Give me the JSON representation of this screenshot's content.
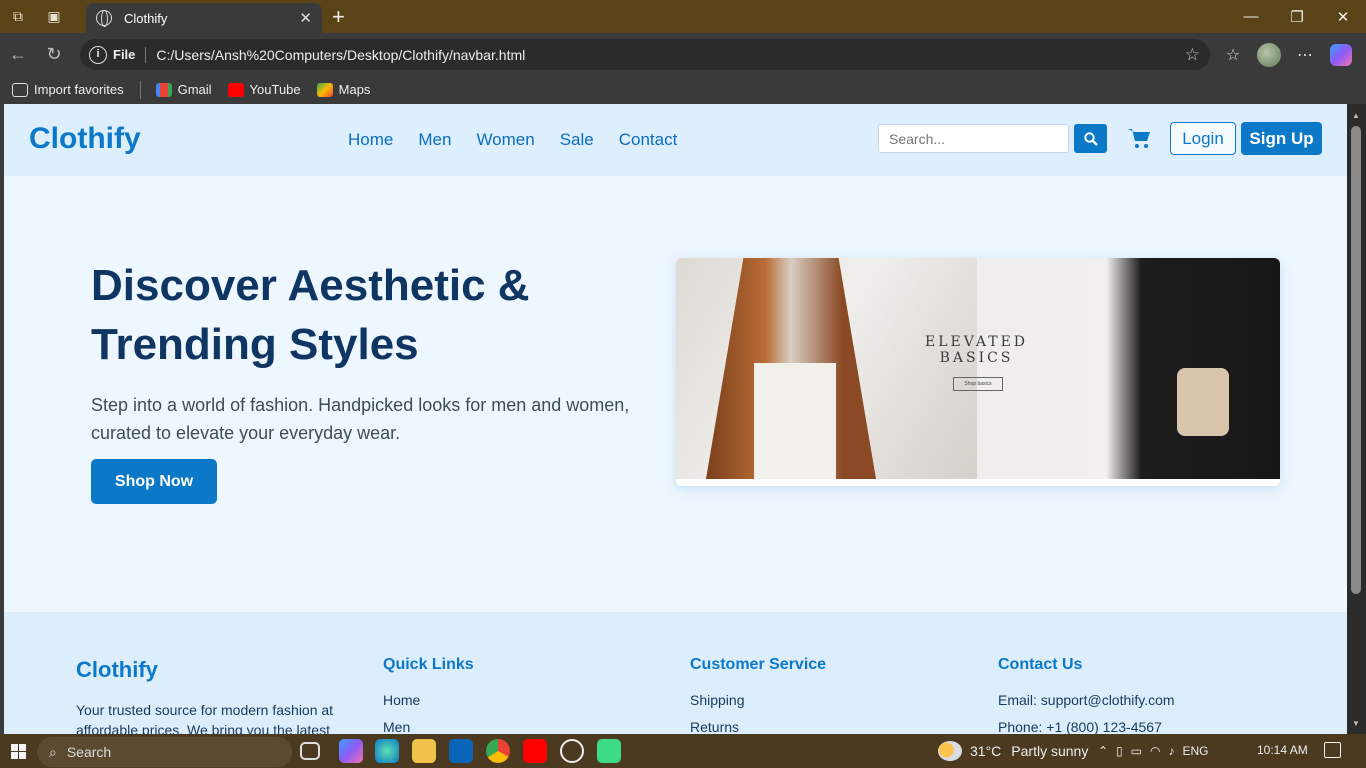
{
  "browser": {
    "tab_title": "Clothify",
    "address_label": "File",
    "address": "C:/Users/Ansh%20Computers/Desktop/Clothify/navbar.html",
    "bookmarks": [
      "Import favorites",
      "Gmail",
      "YouTube",
      "Maps"
    ]
  },
  "site": {
    "logo": "Clothify",
    "nav": [
      "Home",
      "Men",
      "Women",
      "Sale",
      "Contact"
    ],
    "search_placeholder": "Search...",
    "login": "Login",
    "signup": "Sign Up"
  },
  "hero": {
    "title_line1": "Discover Aesthetic &",
    "title_line2": "Trending Styles",
    "subtitle": "Step into a world of fashion. Handpicked looks for men and women, curated to elevate your everyday wear.",
    "button": "Shop Now",
    "image_text_line1": "ELEVATED",
    "image_text_line2": "BASICS",
    "image_button": "Shop basics"
  },
  "footer": {
    "brand": "Clothify",
    "brand_text": "Your trusted source for modern fashion at affordable prices. We bring you the latest",
    "quick_links_title": "Quick Links",
    "quick_links": [
      "Home",
      "Men"
    ],
    "customer_service_title": "Customer Service",
    "customer_service": [
      "Shipping",
      "Returns"
    ],
    "contact_title": "Contact Us",
    "contact": [
      "Email: support@clothify.com",
      "Phone: +1 (800) 123-4567"
    ]
  },
  "taskbar": {
    "search": "Search",
    "weather_temp": "31°C",
    "weather_text": "Partly sunny",
    "language": "ENG",
    "time": "10:14 AM"
  },
  "colors": {
    "brand_blue": "#0b78c8",
    "hero_title": "#0f3563",
    "page_bg": "#eef6fe"
  }
}
